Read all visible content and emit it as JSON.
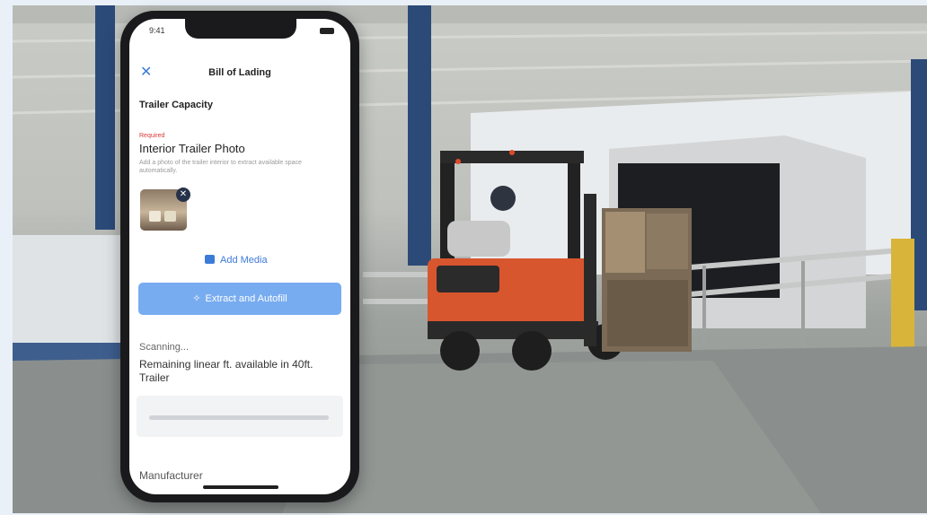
{
  "phone": {
    "status_time": "9:41",
    "app_title": "Bill of Lading",
    "close_icon": "close-icon",
    "section_title": "Trailer Capacity",
    "required_label": "Required",
    "field_title": "Interior Trailer Photo",
    "field_help": "Add a photo of the trailer interior to extract available space automatically.",
    "add_media_label": "Add Media",
    "extract_button_label": "Extract and Autofill",
    "scanning_text": "Scanning...",
    "remaining_label": "Remaining linear ft. available in 40ft. Trailer",
    "next_field_label": "Manufacturer",
    "accent_color": "#3d7bd9",
    "button_color": "#78acf0"
  }
}
